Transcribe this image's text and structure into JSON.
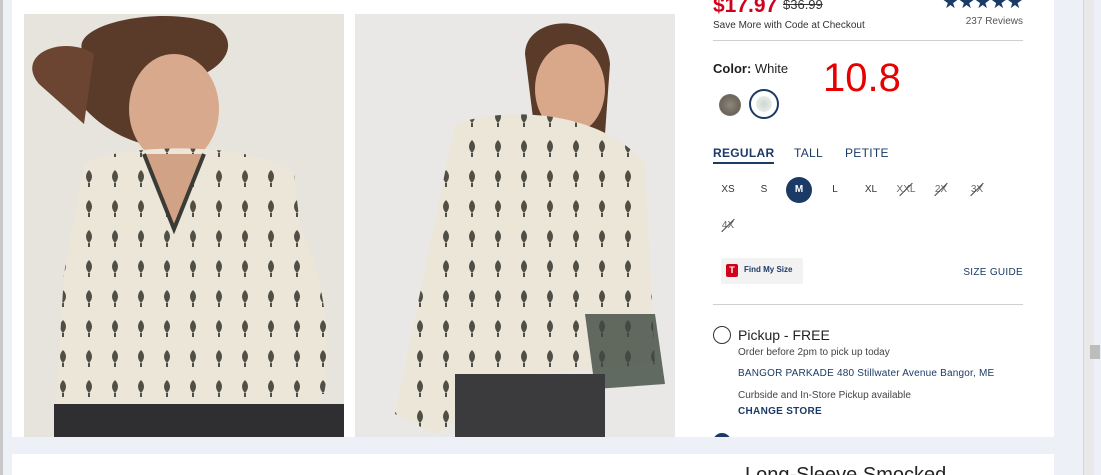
{
  "product": {
    "sale_price": "$17.97",
    "original_price": "$36.99",
    "price_note": "Save More with Code at Checkout",
    "stars": "★★★★★",
    "reviews": "237 Reviews",
    "rating_value": 4.5
  },
  "color": {
    "label": "Color:",
    "value": "White",
    "swatches": [
      "Gray",
      "White"
    ],
    "selected": "White"
  },
  "overlay_number": "10.8",
  "fit_tabs": [
    "REGULAR",
    "TALL",
    "PETITE"
  ],
  "active_fit": "REGULAR",
  "sizes": [
    {
      "label": "XS",
      "state": "available"
    },
    {
      "label": "S",
      "state": "available"
    },
    {
      "label": "M",
      "state": "selected"
    },
    {
      "label": "L",
      "state": "available"
    },
    {
      "label": "XL",
      "state": "available"
    },
    {
      "label": "XXL",
      "state": "unavailable"
    },
    {
      "label": "2X",
      "state": "unavailable"
    },
    {
      "label": "3X",
      "state": "unavailable"
    },
    {
      "label": "4X",
      "state": "unavailable"
    }
  ],
  "find_my_size": {
    "logo": "T",
    "label": "Find My Size"
  },
  "size_guide": "SIZE GUIDE",
  "pickup": {
    "title": "Pickup - FREE",
    "subtitle": "Order before 2pm to pick up today",
    "store": "BANGOR PARKADE 480 Stillwater Avenue  Bangor, ME",
    "curbside": "Curbside and In-Store Pickup available",
    "change_store": "CHANGE STORE"
  },
  "bottom_title": "Long-Sleeve Smocked",
  "colors": {
    "sale_red": "#d0021b",
    "navy": "#1b3a66",
    "overlay_red": "#e60000"
  }
}
